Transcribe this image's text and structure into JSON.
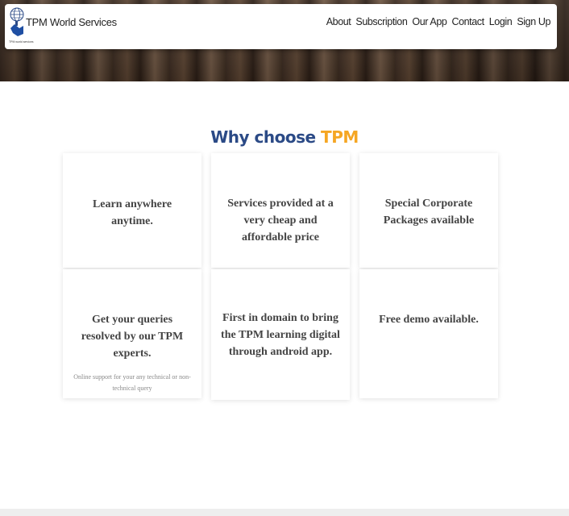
{
  "header": {
    "brand": "TPM World Services",
    "logo_tagline": "TPM world services",
    "nav": [
      "About",
      "Subscription",
      "Our App",
      "Contact",
      "Login",
      "Sign Up"
    ]
  },
  "section": {
    "title_main": "Why choose",
    "title_accent": "TPM"
  },
  "cards": [
    {
      "heading": "Learn anywhere anytime."
    },
    {
      "heading": "Services provided at a very cheap and affordable price"
    },
    {
      "heading": "Special Corporate Packages available"
    },
    {
      "heading": "Get your queries resolved by our TPM experts.",
      "sub": "Online support for your any technical or non-technical query"
    },
    {
      "heading": "First in domain to bring the TPM learning digital through android app."
    },
    {
      "heading": "Free demo available."
    }
  ],
  "colors": {
    "title_main": "#2b4a86",
    "title_accent": "#f5a623",
    "card_text": "#444444"
  }
}
